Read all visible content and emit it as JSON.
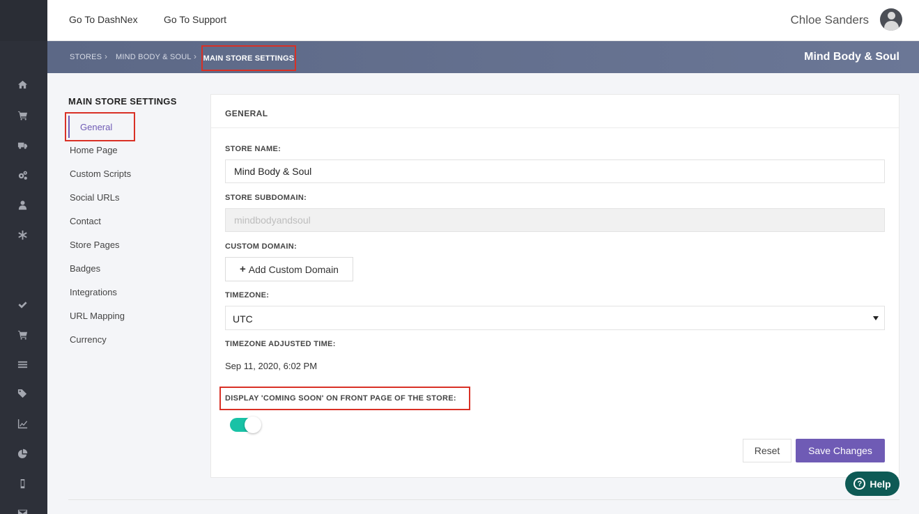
{
  "sidebar": {
    "icons": [
      "home-icon",
      "cart-icon",
      "truck-icon",
      "cogs-icon",
      "user-icon",
      "asterisk-icon",
      "check-icon",
      "cart-icon",
      "list-icon",
      "tags-icon",
      "chart-icon",
      "pie-chart-icon",
      "mobile-icon",
      "envelope-icon"
    ]
  },
  "topbar": {
    "nav": [
      "Go To DashNex",
      "Go To Support"
    ],
    "user_name": "Chloe Sanders"
  },
  "breadcrumb": {
    "items": [
      "STORES",
      "MIND BODY & SOUL"
    ],
    "active": "MAIN STORE SETTINGS",
    "store_title": "Mind Body & Soul"
  },
  "settings_menu": {
    "title": "MAIN STORE SETTINGS",
    "active": "General",
    "items": [
      "Home Page",
      "Custom Scripts",
      "Social URLs",
      "Contact",
      "Store Pages",
      "Badges",
      "Integrations",
      "URL Mapping",
      "Currency"
    ]
  },
  "general": {
    "header": "GENERAL",
    "store_name_label": "STORE NAME:",
    "store_name_value": "Mind Body & Soul",
    "subdomain_label": "STORE SUBDOMAIN:",
    "subdomain_value": "mindbodyandsoul",
    "custom_domain_label": "CUSTOM DOMAIN:",
    "add_domain_label": "Add Custom Domain",
    "timezone_label": "TIMEZONE:",
    "timezone_value": "UTC",
    "adjusted_time_label": "TIMEZONE ADJUSTED TIME:",
    "adjusted_time_value": "Sep 11, 2020, 6:02 PM",
    "coming_soon_label": "DISPLAY 'COMING SOON' ON FRONT PAGE OF THE STORE:",
    "coming_soon_enabled": true,
    "reset_label": "Reset",
    "save_label": "Save Changes"
  },
  "help": {
    "label": "Help"
  },
  "colors": {
    "accent": "#6f5bb5",
    "toggle": "#19c2a6",
    "help": "#0e5a55",
    "highlight": "#d93025"
  }
}
